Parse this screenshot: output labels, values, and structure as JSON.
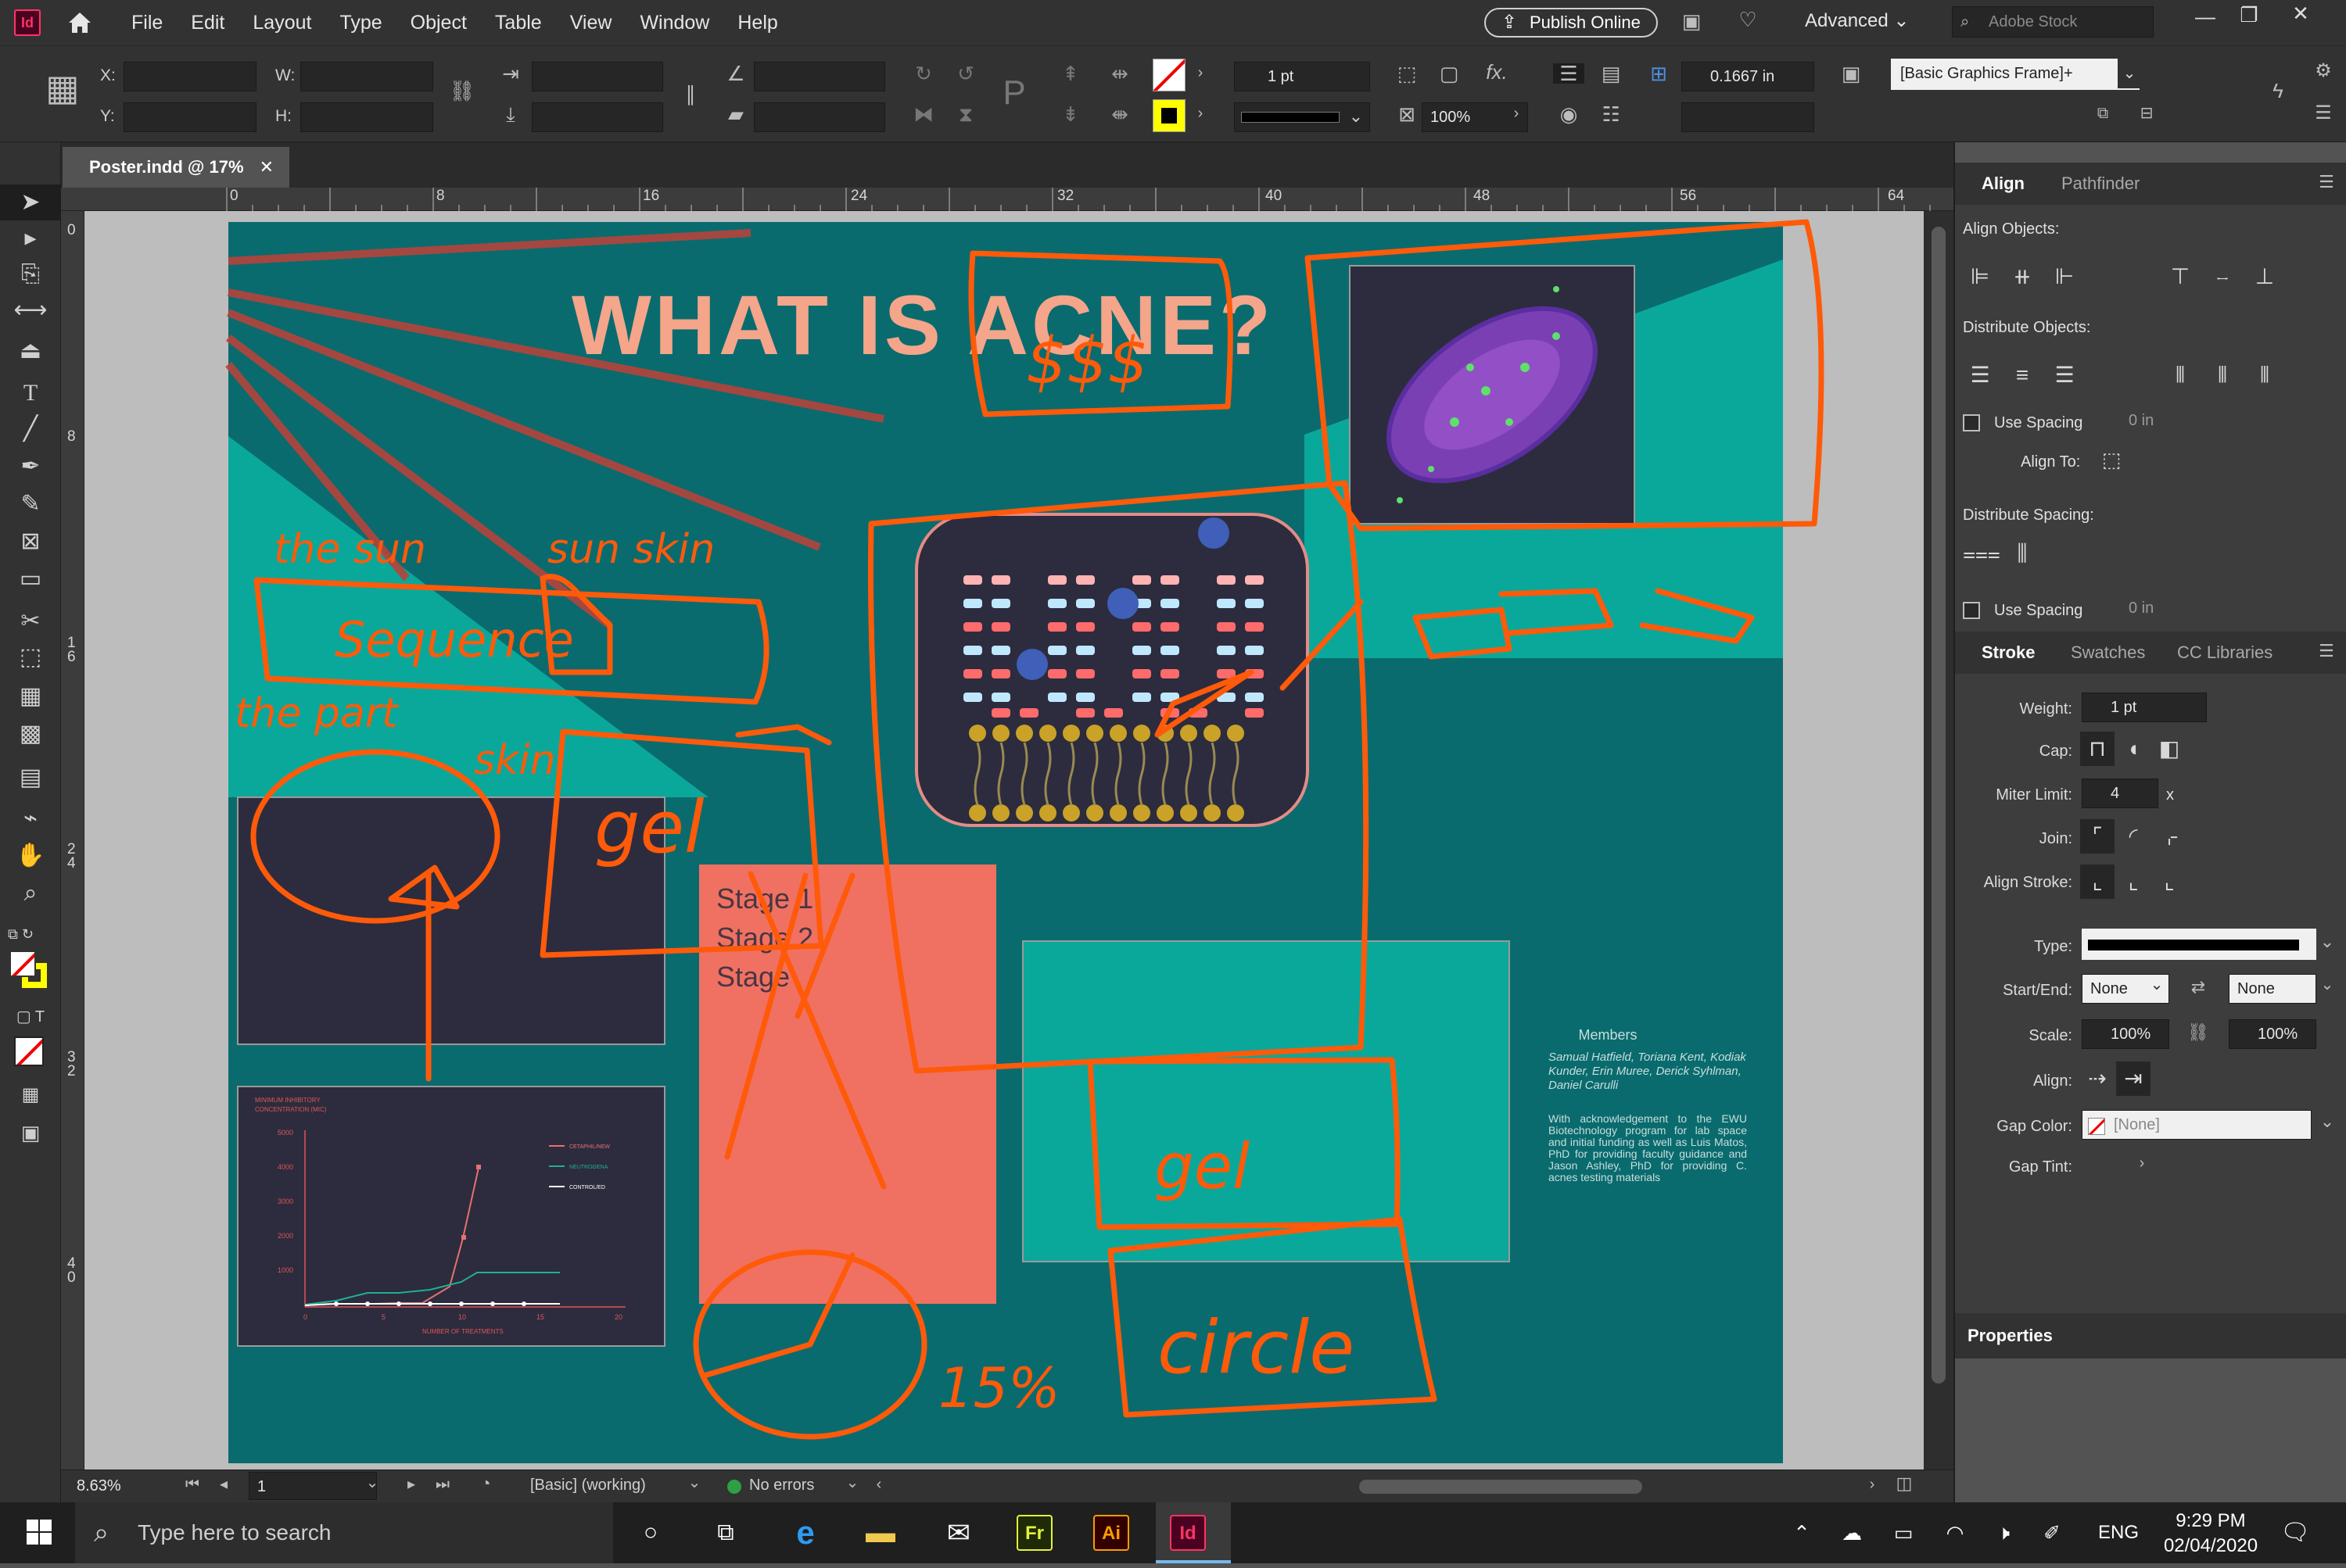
{
  "app": {
    "logo": "Id",
    "accent": "#49021F",
    "accent_fg": "#FF3366"
  },
  "menu": [
    "File",
    "Edit",
    "Layout",
    "Type",
    "Object",
    "Table",
    "View",
    "Window",
    "Help"
  ],
  "publish_label": "Publish Online",
  "workspace_label": "Advanced",
  "search_placeholder": "Adobe Stock",
  "control": {
    "x_label": "X:",
    "y_label": "Y:",
    "w_label": "W:",
    "h_label": "H:",
    "stroke_weight": "1 pt",
    "opacity": "100%",
    "offset": "0.1667 in",
    "object_style": "[Basic Graphics Frame]+",
    "fill_color": "#ffff00"
  },
  "document_tab": {
    "title": "Poster.indd @ 17%",
    "close": "✕"
  },
  "ruler_h": [
    "0",
    "8",
    "16",
    "24",
    "32",
    "40",
    "48",
    "56",
    "64"
  ],
  "ruler_v": [
    "0",
    "8",
    "16",
    "24",
    "32",
    "40"
  ],
  "poster": {
    "title": "WHAT IS ACNE?",
    "stage_lines": [
      "Stage 1:",
      "Stage 2",
      "Stage"
    ],
    "members_heading": "Members",
    "members_names": "Samual Hatfield, Toriana Kent, Kodiak Kunder, Erin Muree, Derick Syhlman, Daniel Carulli",
    "acknowledgement": "With acknowledgement to the EWU Biotechnology program for lab space and initial funding as well as Luis Matos, PhD for providing faculty guidance and Jason Ashley, PhD for providing C. acnes testing materials",
    "colors": {
      "background": "#0a6b6e",
      "light_teal": "#0aa89b",
      "dark_panel": "#2c2c3e",
      "coral": "#f07162",
      "title": "#f4a58a",
      "annotation": "#ff5a0a"
    },
    "chart_legend": [
      "CETAPHIL/NEW",
      "NEUTROGENA",
      "CONTROL/ED"
    ]
  },
  "annotations": [
    "$$$",
    "the sun",
    "sun skin",
    "Sequence",
    "the part",
    "skin",
    "gel",
    "gel",
    "15%",
    "circle"
  ],
  "status": {
    "zoom": "8.63%",
    "page": "1",
    "preflight_profile": "[Basic] (working)",
    "errors": "No errors"
  },
  "panel": {
    "tabs_align": [
      "Align",
      "Pathfinder"
    ],
    "align_objects": "Align Objects:",
    "distribute_objects": "Distribute Objects:",
    "use_spacing": "Use Spacing",
    "spacing_value": "0 in",
    "align_to": "Align To:",
    "distribute_spacing": "Distribute Spacing:",
    "tabs_stroke": [
      "Stroke",
      "Swatches",
      "CC Libraries"
    ],
    "weight_label": "Weight:",
    "weight_value": "1 pt",
    "cap_label": "Cap:",
    "miter_label": "Miter Limit:",
    "miter_value": "4",
    "miter_x": "x",
    "join_label": "Join:",
    "align_stroke_label": "Align Stroke:",
    "type_label": "Type:",
    "start_end_label": "Start/End:",
    "start_value": "None",
    "end_value": "None",
    "scale_label": "Scale:",
    "scale_start": "100%",
    "scale_end": "100%",
    "align_label": "Align:",
    "gap_color_label": "Gap Color:",
    "gap_color_value": "[None]",
    "gap_tint_label": "Gap Tint:",
    "properties": "Properties"
  },
  "taskbar": {
    "search_placeholder": "Type here to search",
    "lang": "ENG",
    "time": "9:29 PM",
    "date": "02/04/2020",
    "apps": [
      {
        "label": "Fr",
        "fg": "#e3f23b",
        "bg": "#1f2b06"
      },
      {
        "label": "Ai",
        "fg": "#ff9a00",
        "bg": "#330000"
      },
      {
        "label": "Id",
        "fg": "#ff3366",
        "bg": "#49021f"
      }
    ]
  }
}
